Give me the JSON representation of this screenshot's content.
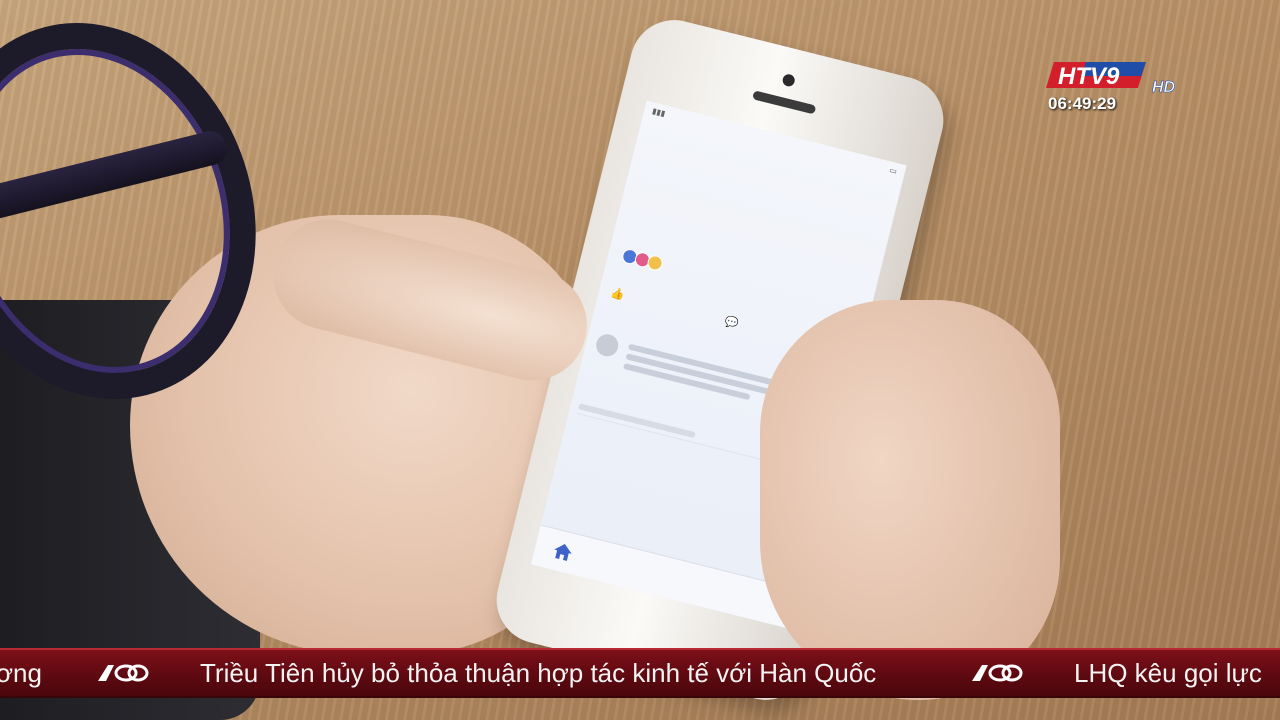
{
  "channel": {
    "logo_text": "HTV9",
    "logo_suffix": "HD",
    "clock": "06:49:29"
  },
  "ticker": {
    "items": [
      "ơng",
      "Triều Tiên hủy bỏ thỏa thuận hợp tác kinh tế với Hàn Quốc",
      "LHQ kêu gọi lực"
    ],
    "logo_icon": "htv-loop-logo-icon"
  },
  "colors": {
    "ticker_bg": "#5c0910",
    "logo_red": "#d21f2b",
    "logo_blue": "#1e4ea8",
    "accent_blue": "#3d63c8"
  }
}
